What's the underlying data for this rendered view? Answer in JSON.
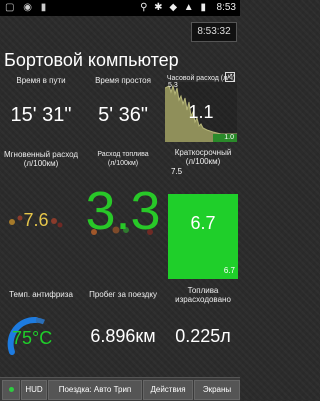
{
  "status_bar": {
    "left_icons": "▢ ◉ ▮",
    "right_icons": "⚲ ✱ ◆ ▲ ▮",
    "time": "8:53"
  },
  "time_box": "8:53:32",
  "title": "Бортовой компьютер",
  "trip_time": {
    "label": "Время в пути",
    "value": "15' 31\""
  },
  "idle_time": {
    "label": "Время простоя",
    "value": "5' 36\""
  },
  "hourly": {
    "label": "Часовой расход (л/ч)",
    "top_value": "5.3",
    "value": "1.1",
    "bottom_value": "1.0"
  },
  "instant": {
    "label": "Мгновенный расход (л/100км)",
    "value": "7.6"
  },
  "fuel_per_100": {
    "label": "Расход топлива (л/100км)",
    "value": "3.3"
  },
  "short_term": {
    "label": "Краткосрочный (л/100км)",
    "top_value": "7.5",
    "value": "6.7",
    "bottom_value": "6.7",
    "fill_fraction": 0.72
  },
  "coolant": {
    "label": "Темп. антифриза",
    "value": "75°C"
  },
  "trip_distance": {
    "label": "Пробег за поездку",
    "value": "6.896км"
  },
  "trip_fuel": {
    "label": "Топлива израсходовано",
    "value": "0.225л"
  },
  "bottom_bar": {
    "hud": "HUD",
    "trip": "Поездка: Авто Трип",
    "actions": "Действия",
    "screens": "Экраны"
  },
  "colors": {
    "green": "#1fcf2a",
    "blue": "#1d7be0"
  }
}
